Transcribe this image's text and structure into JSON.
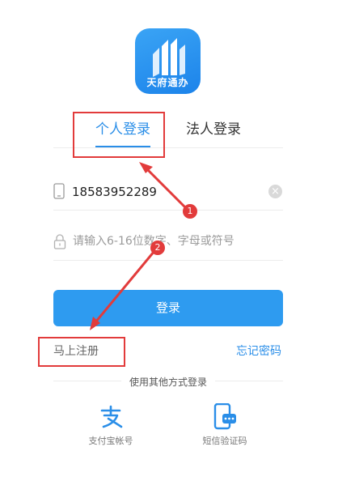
{
  "app": {
    "name": "天府通办",
    "accent_color": "#2a8ee8",
    "logo_icon": "tianfu-tongban-logo"
  },
  "tabs": [
    {
      "label": "个人登录",
      "active": true
    },
    {
      "label": "法人登录",
      "active": false
    }
  ],
  "phone_field": {
    "icon": "phone-icon",
    "value": "18583952289",
    "clear_icon": "clear-icon",
    "clear_glyph": "×"
  },
  "password_field": {
    "icon": "lock-icon",
    "placeholder": "请输入6-16位数字、字母或符号",
    "value": ""
  },
  "login_button": {
    "label": "登录",
    "color": "#2e9bf0"
  },
  "register_link": "马上注册",
  "forgot_password_link": "忘记密码",
  "other_methods": {
    "title": "使用其他方式登录",
    "items": [
      {
        "label": "支付宝帐号",
        "icon": "alipay-icon"
      },
      {
        "label": "短信验证码",
        "icon": "sms-icon"
      }
    ]
  },
  "annotations": {
    "color": "#e23b3b",
    "markers": [
      "1",
      "2"
    ]
  }
}
